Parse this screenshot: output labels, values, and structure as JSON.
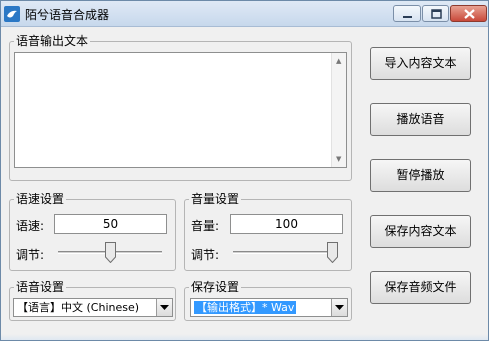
{
  "window": {
    "title": "陌兮语音合成器"
  },
  "output_group": {
    "label": "语音输出文本",
    "text": ""
  },
  "speed": {
    "group_label": "语速设置",
    "field_label": "语速:",
    "value": "50",
    "adjust_label": "调节:",
    "slider_level_percent": 50
  },
  "volume": {
    "group_label": "音量设置",
    "field_label": "音量:",
    "value": "100",
    "adjust_label": "调节:",
    "slider_level_percent": 100
  },
  "voice": {
    "group_label": "语音设置",
    "selected": "【语言】中文 (Chinese)"
  },
  "save": {
    "group_label": "保存设置",
    "selected": "【输出格式】* Wav"
  },
  "buttons": {
    "import": "导入内容文本",
    "play": "播放语音",
    "pause": "暂停播放",
    "save_text": "保存内容文本",
    "save_audio": "保存音频文件"
  }
}
